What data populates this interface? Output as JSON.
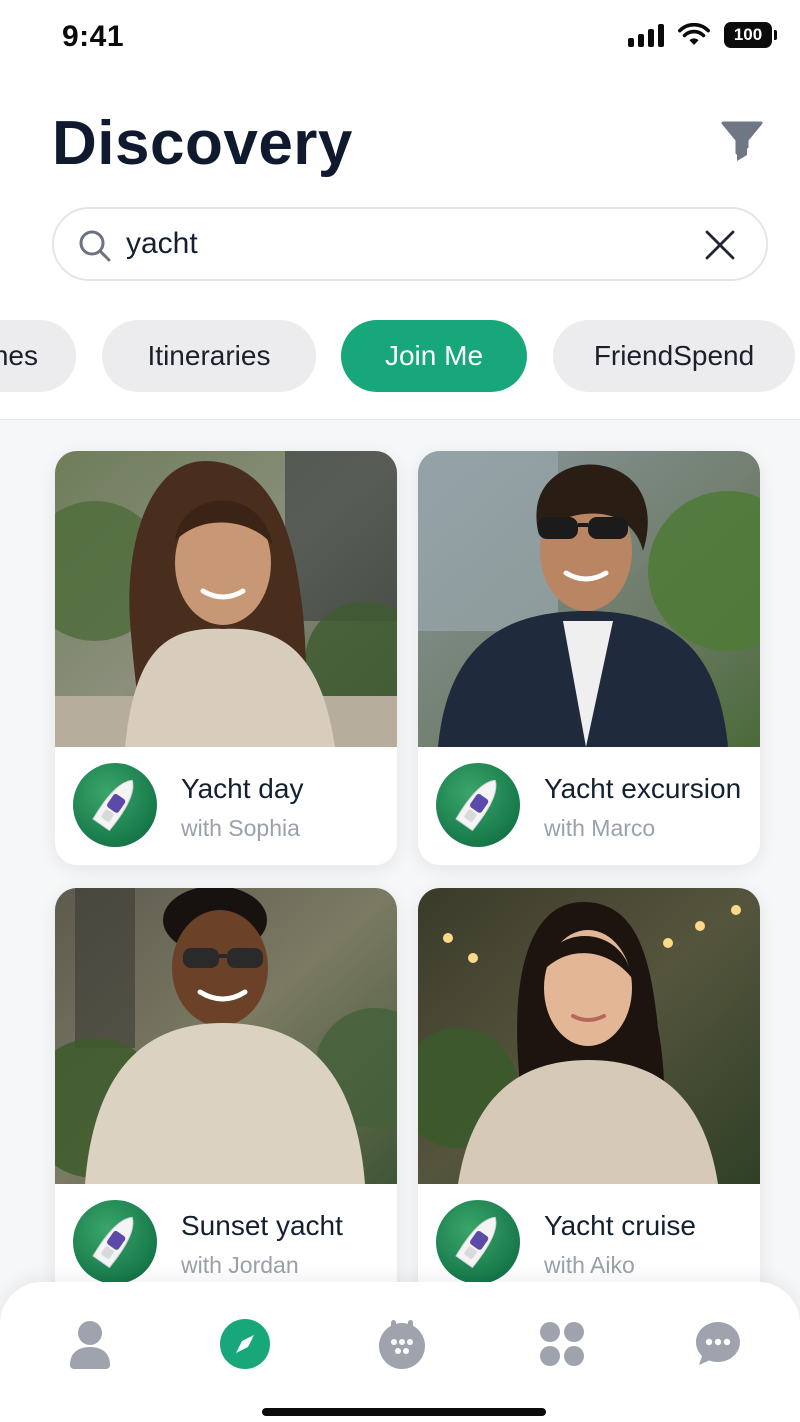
{
  "status_bar": {
    "time": "9:41",
    "battery": "100"
  },
  "header": {
    "title": "Discovery",
    "filter_icon": "funnel-icon"
  },
  "search": {
    "query": "yacht",
    "icon": "search-icon",
    "clear_icon": "close-icon"
  },
  "chips": [
    {
      "label": "nes",
      "active": false
    },
    {
      "label": "Itineraries",
      "active": false
    },
    {
      "label": "Join Me",
      "active": true
    },
    {
      "label": "FriendSpend",
      "active": false
    }
  ],
  "cards": [
    {
      "title": "Yacht day",
      "subtitle": "with Sophia",
      "badge_icon": "yacht-icon"
    },
    {
      "title": "Yacht excursion",
      "subtitle": "with Marco",
      "badge_icon": "yacht-icon"
    },
    {
      "title": "Sunset yacht",
      "subtitle": "with Jordan",
      "badge_icon": "yacht-icon"
    },
    {
      "title": "Yacht cruise",
      "subtitle": "with Aiko",
      "badge_icon": "yacht-icon"
    }
  ],
  "tab_bar": [
    {
      "icon": "profile-icon",
      "active": false
    },
    {
      "icon": "compass-icon",
      "active": true
    },
    {
      "icon": "calendar-icon",
      "active": false
    },
    {
      "icon": "apps-grid-icon",
      "active": false
    },
    {
      "icon": "chat-icon",
      "active": false
    }
  ],
  "colors": {
    "accent": "#17a77a",
    "title": "#0f1a2e",
    "chip_bg": "#ececee",
    "muted_text": "#9aa1ab",
    "icon_gray": "#9ea3ad"
  }
}
